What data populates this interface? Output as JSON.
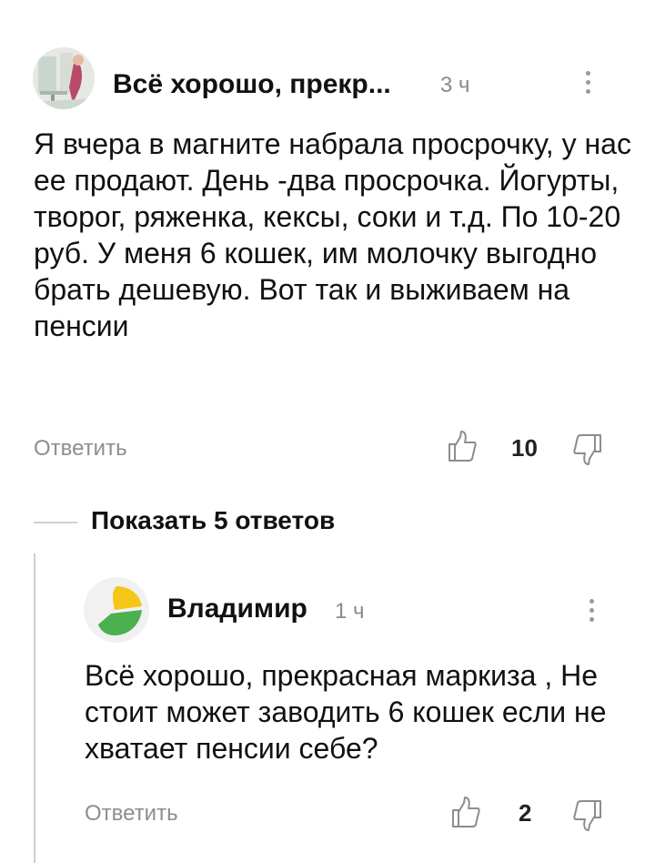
{
  "comment1": {
    "author": "Всё хорошо, прекр...",
    "time": "3 ч",
    "text": "Я вчера в магните набрала просрочку, у нас ее продают. День -два просрочка. Йогурты, творог, ряженка, кексы, соки и т.д. По 10-20 руб. У меня 6 кошек, им молочку выгодно брать дешевую. Вот так и выживаем на пенсии",
    "reply_label": "Ответить",
    "likes": "10",
    "icons": {
      "like": "thumbs-up-icon",
      "dislike": "thumbs-down-icon",
      "more": "more-vertical-icon"
    }
  },
  "show_replies": {
    "label": "Показать 5 ответов"
  },
  "reply1": {
    "author": "Владимир",
    "time": "1 ч",
    "text": "Всё хорошо, прекрасная маркиза , Не стоит может заводить 6 кошек если не хватает пенсии себе?",
    "reply_label": "Ответить",
    "likes": "2",
    "icons": {
      "like": "thumbs-up-icon",
      "dislike": "thumbs-down-icon",
      "more": "more-vertical-icon"
    }
  },
  "colors": {
    "avatar_yellow": "#F5C518",
    "avatar_green": "#4CAF50",
    "muted": "#8d8d8d"
  }
}
